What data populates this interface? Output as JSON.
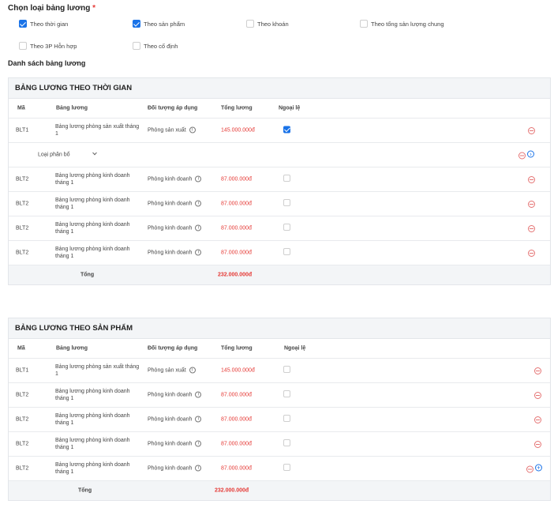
{
  "header": {
    "title": "Chọn loại bảng lương",
    "required_mark": "*"
  },
  "types": [
    {
      "label": "Theo thời gian",
      "checked": true
    },
    {
      "label": "Theo sản phẩm",
      "checked": true
    },
    {
      "label": "Theo khoán",
      "checked": false
    },
    {
      "label": "Theo tổng sản lượng chung",
      "checked": false
    },
    {
      "label": "Theo 3P Hỗn hợp",
      "checked": false
    },
    {
      "label": "Theo cố định",
      "checked": false
    }
  ],
  "list_title": "Danh sách bảng lương",
  "columns": {
    "code": "Mã",
    "name": "Bảng lương",
    "target": "Đối tượng áp dụng",
    "total": "Tổng lương",
    "exception": "Ngoại lệ"
  },
  "info_glyph": "i",
  "add_glyph": "+",
  "tables": [
    {
      "title": "BẢNG LƯƠNG THEO THỜI GIAN",
      "rows": [
        {
          "code": "BLT1",
          "name": "Bảng lương phòng sản xuất tháng 1",
          "target": "Phòng sản xuất",
          "total": "145.000.000đ",
          "exception": true
        },
        {
          "code": "BLT2",
          "name": "Bảng lương phòng kinh doanh tháng 1",
          "target": "Phòng kinh doanh",
          "total": "87.000.000đ",
          "exception": false
        },
        {
          "code": "BLT2",
          "name": "Bảng lương phòng kinh doanh tháng 1",
          "target": "Phòng kinh doanh",
          "total": "87.000.000đ",
          "exception": false
        },
        {
          "code": "BLT2",
          "name": "Bảng lương phòng kinh doanh tháng 1",
          "target": "Phòng kinh doanh",
          "total": "87.000.000đ",
          "exception": false
        },
        {
          "code": "BLT2",
          "name": "Bảng lương phòng kinh doanh tháng 1",
          "target": "Phòng kinh doanh",
          "total": "87.000.000đ",
          "exception": false
        }
      ],
      "sub_row": {
        "label": "Loại phân bổ"
      },
      "total_label": "Tổng",
      "total_value": "232.000.000đ"
    },
    {
      "title": "BẢNG LƯƠNG THEO SẢN PHẨM",
      "rows": [
        {
          "code": "BLT1",
          "name": "Bảng lương phòng sản xuất tháng 1",
          "target": "Phòng sản xuất",
          "total": "145.000.000đ",
          "exception": false
        },
        {
          "code": "BLT2",
          "name": "Bảng lương phòng kinh doanh tháng 1",
          "target": "Phòng kinh doanh",
          "total": "87.000.000đ",
          "exception": false
        },
        {
          "code": "BLT2",
          "name": "Bảng lương phòng kinh doanh tháng 1",
          "target": "Phòng kinh doanh",
          "total": "87.000.000đ",
          "exception": false
        },
        {
          "code": "BLT2",
          "name": "Bảng lương phòng kinh doanh tháng 1",
          "target": "Phòng kinh doanh",
          "total": "87.000.000đ",
          "exception": false
        },
        {
          "code": "BLT2",
          "name": "Bảng lương phòng kinh doanh tháng 1",
          "target": "Phòng kinh doanh",
          "total": "87.000.000đ",
          "exception": false
        }
      ],
      "total_label": "Tổng",
      "total_value": "232.000.000đ"
    }
  ]
}
